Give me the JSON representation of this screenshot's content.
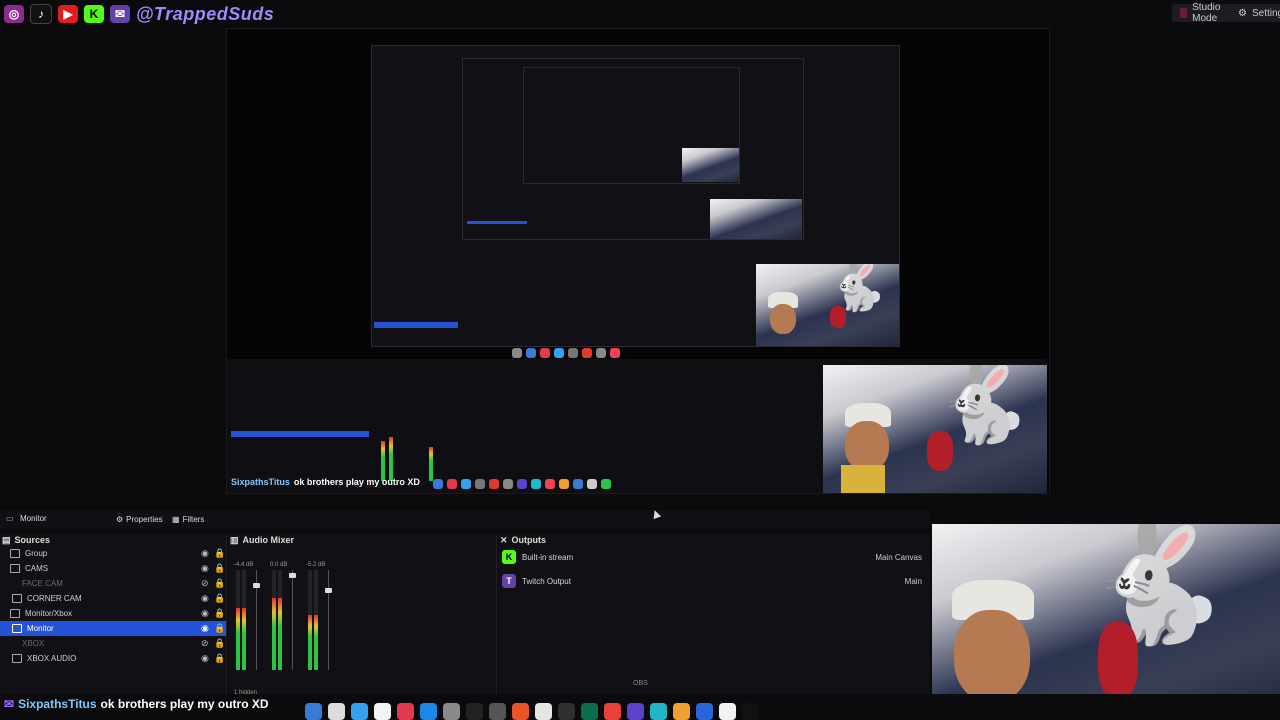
{
  "topbar": {
    "social_icons": [
      "instagram-icon",
      "tiktok-icon",
      "youtube-icon",
      "kick-icon",
      "twitch-icon"
    ],
    "handle": "@TrappedSuds",
    "studio_mode_label": "Studio Mode",
    "settings_label": "Settings"
  },
  "scene": {
    "current_scene": "Monitor",
    "properties_label": "Properties",
    "filters_label": "Filters"
  },
  "sources": {
    "title": "Sources",
    "items": [
      {
        "label": "Group"
      },
      {
        "label": "CAMS"
      },
      {
        "label": "FACE CAM"
      },
      {
        "label": "CORNER CAM"
      },
      {
        "label": "Monitor/Xbox"
      },
      {
        "label": "Monitor"
      },
      {
        "label": "XBOX"
      },
      {
        "label": "XBOX AUDIO"
      }
    ],
    "footer": "1 hidden"
  },
  "mixer": {
    "title": "Audio Mixer",
    "channels": [
      {
        "db": "-4.4 dB",
        "level": 0.62,
        "fader": 0.85
      },
      {
        "db": "0.0 dB",
        "level": 0.72,
        "fader": 0.95
      },
      {
        "db": "-5.2 dB",
        "level": 0.55,
        "fader": 0.8
      }
    ]
  },
  "outputs": {
    "title": "Outputs",
    "items": [
      {
        "label": "Built-in stream",
        "target": "Main Canvas"
      },
      {
        "label": "Twitch Output",
        "target": "Main"
      }
    ]
  },
  "chat": {
    "user": "SixpathsTitus",
    "message": "ok brothers play my outro XD"
  },
  "obs_label": "OBS",
  "colors": {
    "selection": "#2453d8",
    "accent_kick": "#53fc18",
    "accent_twitch": "#6441a5"
  }
}
